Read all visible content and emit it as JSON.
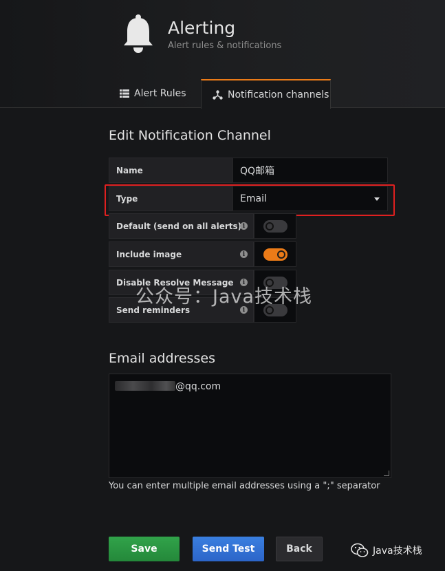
{
  "header": {
    "title": "Alerting",
    "subtitle": "Alert rules & notifications",
    "icon": "bell-icon"
  },
  "tabs": [
    {
      "label": "Alert Rules",
      "icon": "list-icon",
      "active": false
    },
    {
      "label": "Notification channels",
      "icon": "channels-icon",
      "active": true
    }
  ],
  "form": {
    "section_title": "Edit Notification Channel",
    "name_label": "Name",
    "name_value": "QQ邮箱",
    "type_label": "Type",
    "type_value": "Email",
    "toggles": [
      {
        "label": "Default (send on all alerts)",
        "on": false
      },
      {
        "label": "Include image",
        "on": true
      },
      {
        "label": "Disable Resolve Message",
        "on": false
      },
      {
        "label": "Send reminders",
        "on": false
      }
    ]
  },
  "email": {
    "section_title": "Email addresses",
    "value_suffix": "@qq.com",
    "help": "You can enter multiple email addresses using a \";\" separator"
  },
  "buttons": {
    "save": "Save",
    "send_test": "Send Test",
    "back": "Back"
  },
  "watermark": "公众号：Java技术栈",
  "wechat_label": "Java技术栈",
  "colors": {
    "accent": "#eb7b18",
    "save": "#299c46",
    "send_test": "#3274d9",
    "highlight": "#e02020"
  }
}
